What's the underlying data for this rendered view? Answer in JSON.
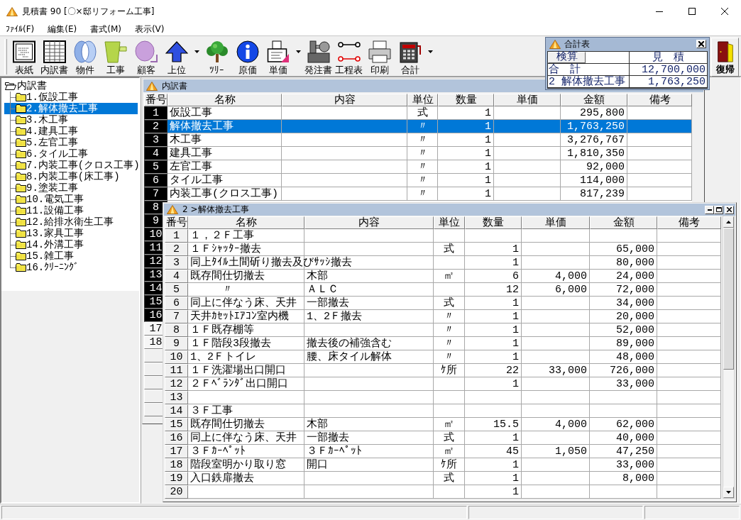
{
  "window": {
    "title": "見積書 90 [〇×邸リフォーム工事]"
  },
  "menu": [
    "ﾌｧｲﾙ(F)",
    "編集(E)",
    "書式(M)",
    "表示(V)"
  ],
  "toolbar": [
    {
      "label": "表紙",
      "dropdown": false
    },
    {
      "label": "内訳書",
      "dropdown": false
    },
    {
      "label": "物件",
      "dropdown": false
    },
    {
      "label": "工事",
      "dropdown": false
    },
    {
      "label": "顧客",
      "dropdown": false
    },
    {
      "label": "上位",
      "dropdown": true
    },
    {
      "label": "ﾂﾘｰ",
      "dropdown": false
    },
    {
      "label": "原価",
      "dropdown": false
    },
    {
      "label": "単価",
      "dropdown": true
    },
    {
      "label": "発注書",
      "dropdown": false
    },
    {
      "label": "工程表",
      "dropdown": false
    },
    {
      "label": "印刷",
      "dropdown": false
    },
    {
      "label": "合計",
      "dropdown": true
    }
  ],
  "return_button": "復帰",
  "summary_panel": {
    "title": "合計表",
    "button": "検算",
    "column": "見　積",
    "rows": [
      {
        "label": "合　計",
        "value": "12,700,000"
      },
      {
        "label": "2 解体撤去工事",
        "value": "1,763,250"
      }
    ]
  },
  "tree": {
    "label": "内訳書",
    "expanded": true,
    "children": [
      {
        "label": "1.仮設工事",
        "selected": false
      },
      {
        "label": "2.解体撤去工事",
        "selected": true
      },
      {
        "label": "3.木工事",
        "selected": false
      },
      {
        "label": "4.建具工事",
        "selected": false
      },
      {
        "label": "5.左官工事",
        "selected": false
      },
      {
        "label": "6.タイル工事",
        "selected": false
      },
      {
        "label": "7.内装工事(クロス工事)",
        "selected": false
      },
      {
        "label": "8.内装工事(床工事)",
        "selected": false
      },
      {
        "label": "9.塗装工事",
        "selected": false
      },
      {
        "label": "10.電気工事",
        "selected": false
      },
      {
        "label": "11.設備工事",
        "selected": false
      },
      {
        "label": "12.給排水衛生工事",
        "selected": false
      },
      {
        "label": "13.家具工事",
        "selected": false
      },
      {
        "label": "14.外溝工事",
        "selected": false
      },
      {
        "label": "15.雑工事",
        "selected": false
      },
      {
        "label": "16.ｸﾘｰﾆﾝｸﾞ",
        "selected": false
      }
    ]
  },
  "breakdown_window": {
    "title": "内訳書",
    "columns": [
      "番号",
      "名称",
      "内容",
      "単位",
      "数量",
      "単価",
      "金額",
      "備考"
    ],
    "rows": [
      {
        "number": "1",
        "kind": "filled",
        "selected": false,
        "name": "仮設工事",
        "unit": "式",
        "quantity": "1",
        "amount": "295,800"
      },
      {
        "number": "2",
        "kind": "filled",
        "selected": true,
        "name": "解体撤去工事",
        "unit": "〃",
        "quantity": "1",
        "amount": "1,763,250"
      },
      {
        "number": "3",
        "kind": "filled",
        "selected": false,
        "name": "木工事",
        "unit": "〃",
        "quantity": "1",
        "amount": "3,276,767"
      },
      {
        "number": "4",
        "kind": "filled",
        "selected": false,
        "name": "建具工事",
        "unit": "〃",
        "quantity": "1",
        "amount": "1,810,350"
      },
      {
        "number": "5",
        "kind": "filled",
        "selected": false,
        "name": "左官工事",
        "unit": "〃",
        "quantity": "1",
        "amount": "92,000"
      },
      {
        "number": "6",
        "kind": "filled",
        "selected": false,
        "name": "タイル工事",
        "unit": "〃",
        "quantity": "1",
        "amount": "114,000"
      },
      {
        "number": "7",
        "kind": "filled",
        "selected": false,
        "name": "内装工事(クロス工事)",
        "unit": "〃",
        "quantity": "1",
        "amount": "817,239"
      },
      {
        "number": "8",
        "kind": "filled"
      },
      {
        "number": "9",
        "kind": "filled"
      },
      {
        "number": "10",
        "kind": "filled"
      },
      {
        "number": "11",
        "kind": "filled"
      },
      {
        "number": "12",
        "kind": "filled"
      },
      {
        "number": "13",
        "kind": "filled"
      },
      {
        "number": "14",
        "kind": "filled"
      },
      {
        "number": "15",
        "kind": "filled"
      },
      {
        "number": "16",
        "kind": "filled"
      },
      {
        "number": "17",
        "kind": "blank"
      },
      {
        "number": "18",
        "kind": "blank"
      }
    ]
  },
  "detail_window": {
    "title": "2 >解体撤去工事",
    "columns": [
      "番号",
      "名称",
      "内容",
      "単位",
      "数量",
      "単価",
      "金額",
      "備考"
    ],
    "rows": [
      {
        "number": "1",
        "name": "１，２Ｆ工事"
      },
      {
        "number": "2",
        "name": "１Ｆｼｬｯﾀｰ撤去",
        "unit": "式",
        "quantity": "1",
        "amount": "65,000"
      },
      {
        "number": "3",
        "name": "同上ﾀｲﾙ土間斫り撤去及びｻｯｼ撤去",
        "quantity": "1",
        "amount": "80,000"
      },
      {
        "number": "4",
        "name": "既存間仕切撤去",
        "content": "木部",
        "unit": "㎡",
        "quantity": "6",
        "unit_price": "4,000",
        "amount": "24,000"
      },
      {
        "number": "5",
        "name": "　　　〃",
        "content": "ＡＬＣ",
        "quantity": "12",
        "unit_price": "6,000",
        "amount": "72,000"
      },
      {
        "number": "6",
        "name": "同上に伴なう床、天井",
        "content": "一部撤去",
        "unit": "式",
        "quantity": "1",
        "amount": "34,000"
      },
      {
        "number": "7",
        "name": "天井ｶｾｯﾄｴｱｺﾝ室内機",
        "content": "1、2Ｆ撤去",
        "unit": "〃",
        "quantity": "1",
        "amount": "20,000"
      },
      {
        "number": "8",
        "name": "１Ｆ既存棚等",
        "unit": "〃",
        "quantity": "1",
        "amount": "52,000"
      },
      {
        "number": "9",
        "name": "１Ｆ階段3段撤去",
        "content": "撤去後の補強含む",
        "unit": "〃",
        "quantity": "1",
        "amount": "89,000"
      },
      {
        "number": "10",
        "name": "1、2Ｆトイレ",
        "content": "腰、床タイル解体",
        "unit": "〃",
        "quantity": "1",
        "amount": "48,000"
      },
      {
        "number": "11",
        "name": "１Ｆ洗濯場出口開口",
        "unit": "ｹ所",
        "quantity": "22",
        "unit_price": "33,000",
        "amount": "726,000"
      },
      {
        "number": "12",
        "name": "２Ｆﾍﾞﾗﾝﾀﾞ出口開口",
        "quantity": "1",
        "amount": "33,000"
      },
      {
        "number": "13"
      },
      {
        "number": "14",
        "name": "３Ｆ工事"
      },
      {
        "number": "15",
        "name": "既存間仕切撤去",
        "content": "木部",
        "unit": "㎡",
        "quantity": "15.5",
        "unit_price": "4,000",
        "amount": "62,000"
      },
      {
        "number": "16",
        "name": "同上に伴なう床、天井",
        "content": "一部撤去",
        "unit": "式",
        "quantity": "1",
        "amount": "40,000"
      },
      {
        "number": "17",
        "name": "３Ｆｶｰﾍﾟｯﾄ",
        "content": "３Ｆｶｰﾍﾟｯﾄ",
        "unit": "㎡",
        "quantity": "45",
        "unit_price": "1,050",
        "amount": "47,250"
      },
      {
        "number": "18",
        "name": "階段室明かり取り窓",
        "content": "開口",
        "unit": "ｹ所",
        "quantity": "1",
        "amount": "33,000"
      },
      {
        "number": "19",
        "name": "入口鉄扉撤去",
        "unit": "式",
        "quantity": "1",
        "amount": "8,000"
      },
      {
        "number": "20",
        "quantity": "1"
      }
    ]
  }
}
